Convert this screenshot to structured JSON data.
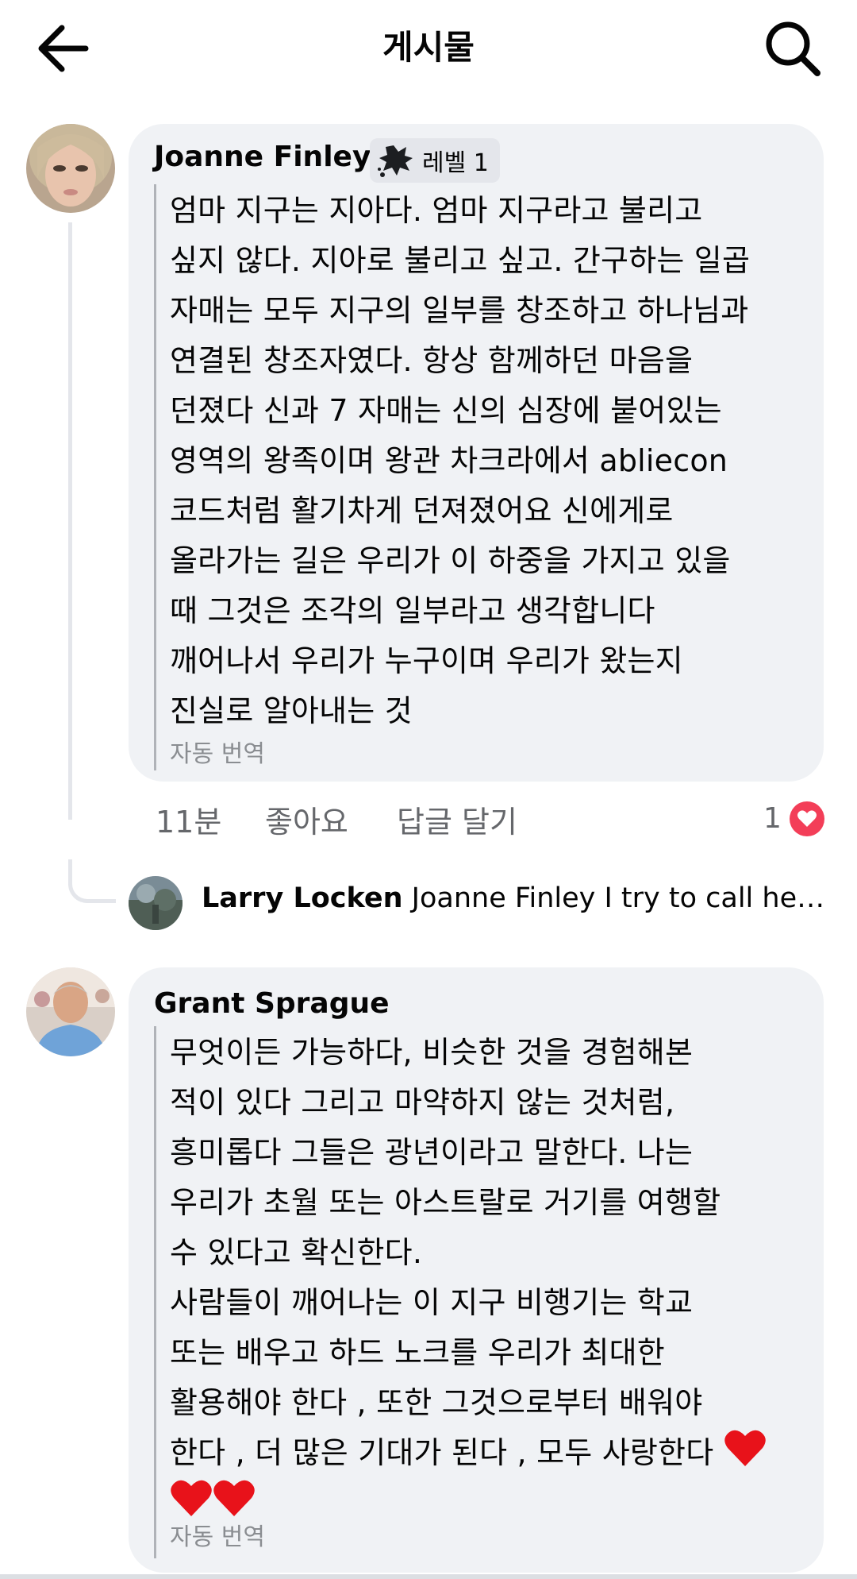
{
  "header": {
    "title": "게시물",
    "back_icon": "arrow-left-icon",
    "search_icon": "search-icon"
  },
  "colors": {
    "bubble_bg": "#f0f2f5",
    "secondary_text": "#65676b",
    "heart": "#f33e58"
  },
  "comments": [
    {
      "author": "Joanne Finley",
      "badge": {
        "icon": "splat-icon",
        "label": "레벨 1"
      },
      "lines": [
        "엄마 지구는 지아다. 엄마 지구라고 불리고",
        "싶지 않다. 지아로 불리고 싶고. 간구하는 일곱",
        "자매는 모두 지구의 일부를 창조하고 하나님과",
        "연결된 창조자였다. 항상 함께하던 마음을",
        "던졌다 신과 7 자매는 신의 심장에 붙어있는",
        "영역의 왕족이며 왕관 차크라에서 abliecon",
        "코드처럼 활기차게 던져졌어요 신에게로",
        "올라가는 길은 우리가 이 하중을 가지고 있을",
        "때 그것은 조각의 일부라고 생각합니다",
        "깨어나서 우리가 누구이며 우리가 왔는지",
        "진실로 알아내는 것"
      ],
      "auto_translate": "자동 번역",
      "time": "11분",
      "like_label": "좋아요",
      "reply_label": "답글 달기",
      "reaction_count": "1",
      "reaction_icon": "heart-icon"
    },
    {
      "author": "Grant Sprague",
      "lines": [
        "무엇이든 가능하다, 비슷한 것을 경험해본",
        "적이 있다 그리고 마약하지 않는 것처럼,",
        "흥미롭다 그들은 광년이라고 말한다. 나는",
        "우리가 초월 또는 아스트랄로 거기를 여행할",
        "수 있다고 확신한다.",
        "사람들이 깨어나는 이 지구 비행기는 학교",
        "또는 배우고 하드 노크를 우리가 최대한",
        "활용해야 한다 , 또한 그것으로부터 배워야",
        "한다 , 더 많은 기대가 된다 , 모두 사랑한다"
      ],
      "emoji": "red-heart-emoji",
      "auto_translate": "자동 번역"
    }
  ],
  "reply_preview": {
    "author": "Larry Locken",
    "text": "Joanne Finley I try to call her mo..."
  }
}
